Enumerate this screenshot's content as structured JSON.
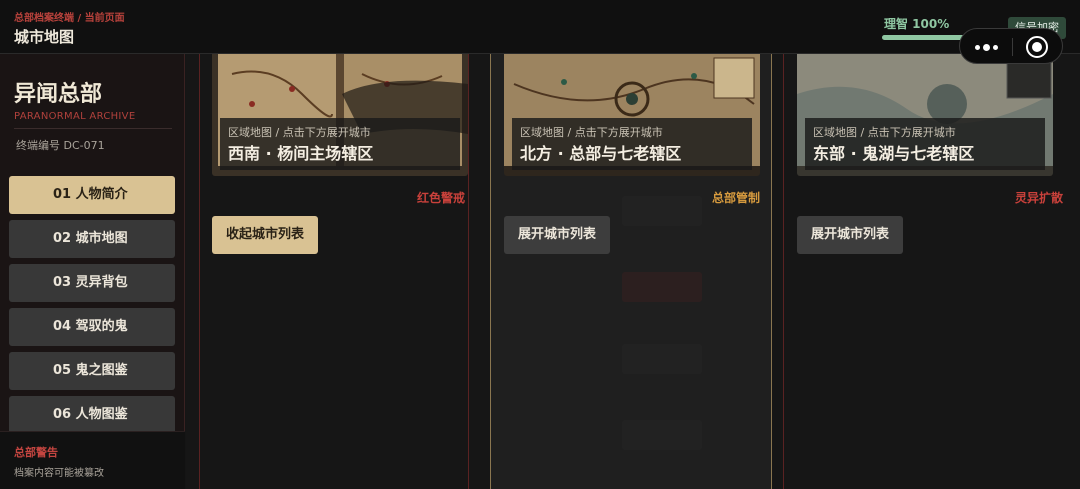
{
  "header": {
    "breadcrumb": "总部档案终端 / 当前页面",
    "title": "城市地图",
    "sanity_label": "理智 100%",
    "sanity_value": 1.0,
    "signal_label": "信号加密"
  },
  "sidebar": {
    "brand": "异闻总部",
    "brand_sub": "PARANORMAL ARCHIVE",
    "terminal_id": "终端编号 DC-071",
    "items": [
      {
        "label": "01  人物简介",
        "active": true
      },
      {
        "label": "02  城市地图",
        "active": false
      },
      {
        "label": "03  灵异背包",
        "active": false
      },
      {
        "label": "04  驾驭的鬼",
        "active": false
      },
      {
        "label": "05  鬼之图鉴",
        "active": false
      },
      {
        "label": "06  人物图鉴",
        "active": false
      }
    ],
    "footer_title": "总部警告",
    "footer_desc": "档案内容可能被篡改"
  },
  "regions": [
    {
      "caption": "区域地图 / 点击下方展开城市",
      "name": "西南 · 杨间主场辖区",
      "status": "红色警戒",
      "status_color": "#c9413b",
      "button": "收起城市列表",
      "expanded": true
    },
    {
      "caption": "区域地图 / 点击下方展开城市",
      "name": "北方 · 总部与七老辖区",
      "status": "总部管制",
      "status_color": "#d69a3e",
      "button": "展开城市列表",
      "expanded": false
    },
    {
      "caption": "区域地图 / 点击下方展开城市",
      "name": "东部 · 鬼湖与七老辖区",
      "status": "灵异扩散",
      "status_color": "#c9413b",
      "button": "展开城市列表",
      "expanded": false
    }
  ],
  "colors": {
    "accent_gold": "#d9c293",
    "danger_red": "#c9413b",
    "control_orange": "#d69a3e",
    "sanity_green": "#8fc7a2"
  }
}
